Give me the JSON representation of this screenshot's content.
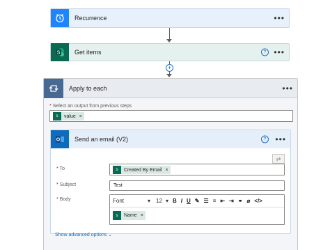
{
  "steps": {
    "recurrence": {
      "title": "Recurrence",
      "more": "•••"
    },
    "get_items": {
      "title": "Get items",
      "more": "•••",
      "help": "?"
    },
    "apply_each": {
      "title": "Apply to each",
      "more": "•••",
      "select_label": "Select an output from previous steps",
      "token": {
        "label": "value",
        "remove": "×"
      }
    },
    "send_email": {
      "title": "Send an email (V2)",
      "more": "•••",
      "help": "?",
      "to_label": "To",
      "to_token": {
        "label": "Created By Email",
        "remove": "×"
      },
      "subject_label": "Subject",
      "subject_value": "Test",
      "body_label": "Body",
      "font_value": "Font",
      "size_value": "12",
      "toolbar": {
        "bold": "B",
        "italic": "I",
        "underline": "U",
        "pen": "✎",
        "bullets": "☰",
        "numbered": "≡",
        "outdent": "⇤",
        "indent": "⇥",
        "link": "⚭",
        "unlink": "⌀",
        "code": "</>"
      },
      "body_token": {
        "label": "Name",
        "remove": "×"
      },
      "show_advanced": "Show advanced options"
    }
  },
  "colors": {
    "recurrence": "#1f85ff",
    "sharepoint": "#0b6a53",
    "apply_each": "#486991",
    "outlook": "#0f6cbd",
    "required_star": "#a4262c"
  },
  "icons": {
    "recurrence": "alarm-clock-icon",
    "sharepoint": "sharepoint-icon",
    "loop": "loop-icon",
    "outlook": "outlook-icon"
  }
}
